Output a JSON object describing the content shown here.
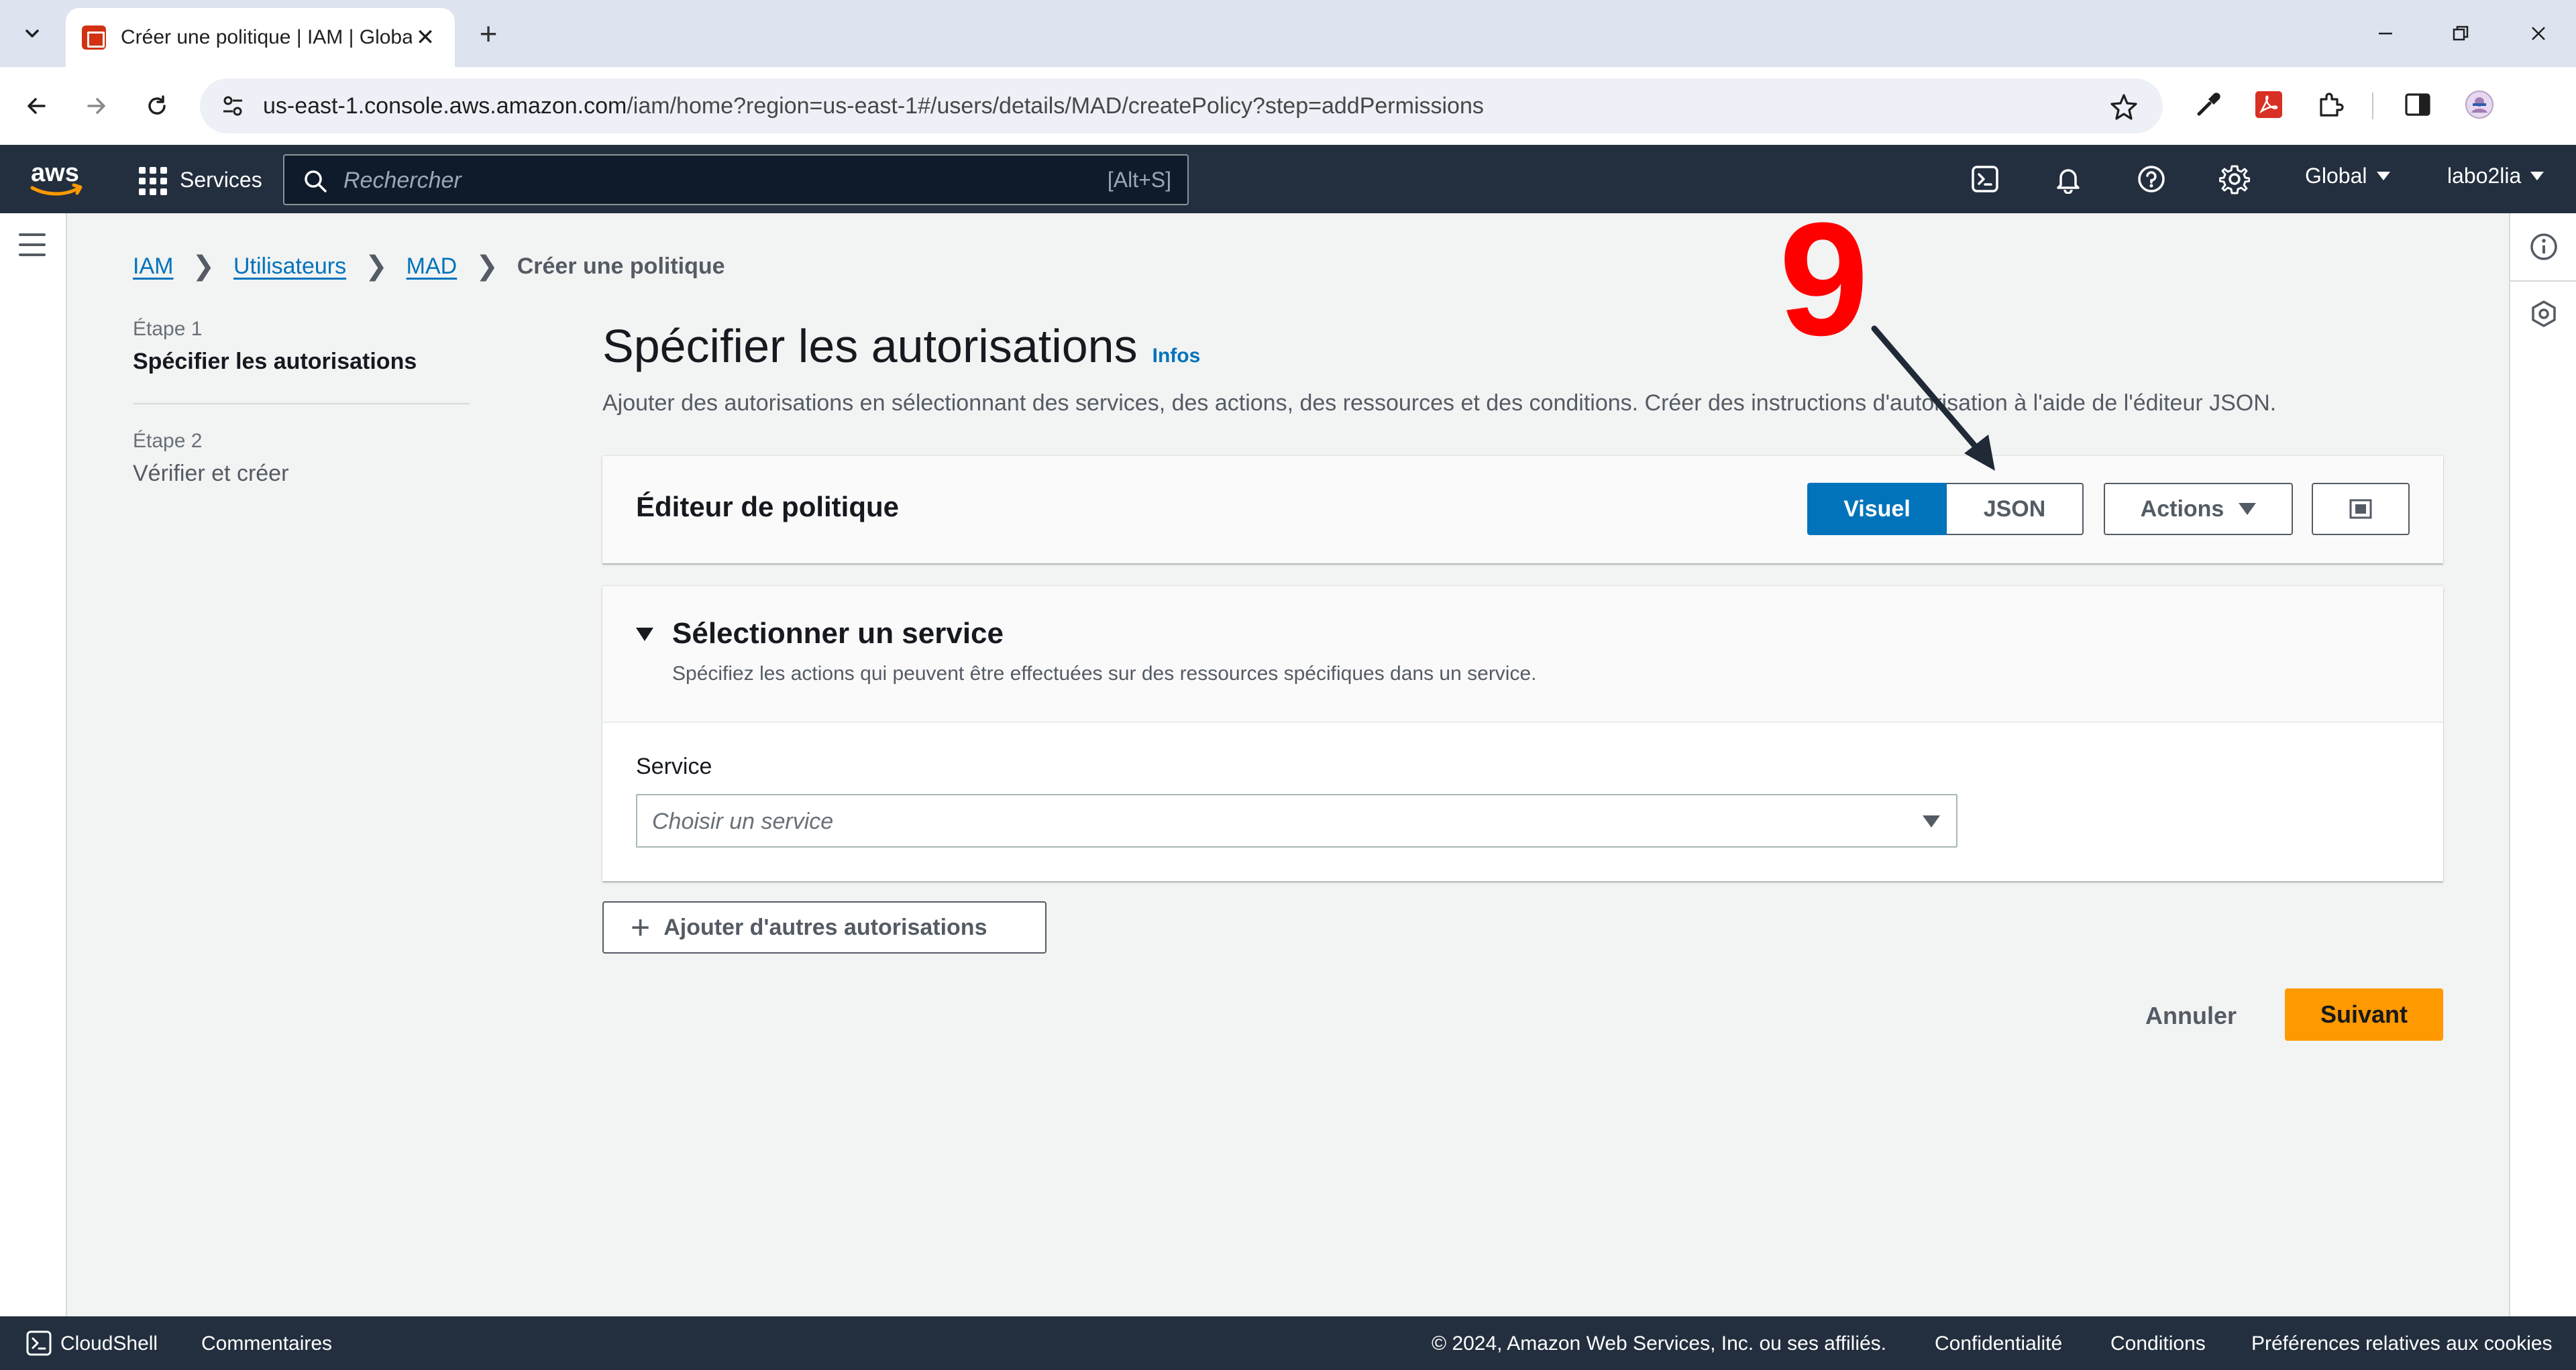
{
  "browser": {
    "tab_title": "Créer une politique | IAM | Global",
    "url_host": "us-east-1.console.aws.amazon.com",
    "url_path": "/iam/home?region=us-east-1#/users/details/MAD/createPolicy?step=addPermissions"
  },
  "aws_header": {
    "logo_text": "aws",
    "services_label": "Services",
    "search_placeholder": "Rechercher",
    "search_shortcut": "[Alt+S]",
    "region": "Global",
    "account": "labo2lia"
  },
  "breadcrumb": {
    "items": [
      "IAM",
      "Utilisateurs",
      "MAD"
    ],
    "current": "Créer une politique"
  },
  "steps": [
    {
      "number": "Étape 1",
      "label": "Spécifier les autorisations"
    },
    {
      "number": "Étape 2",
      "label": "Vérifier et créer"
    }
  ],
  "page": {
    "title": "Spécifier les autorisations",
    "info": "Infos",
    "description": "Ajouter des autorisations en sélectionnant des services, des actions, des ressources et des conditions. Créer des instructions d'autorisation à l'aide de l'éditeur JSON."
  },
  "editor": {
    "title": "Éditeur de politique",
    "visual_label": "Visuel",
    "json_label": "JSON",
    "actions_label": "Actions"
  },
  "service_section": {
    "title": "Sélectionner un service",
    "subtitle": "Spécifiez les actions qui peuvent être effectuées sur des ressources spécifiques dans un service.",
    "field_label": "Service",
    "select_placeholder": "Choisir un service"
  },
  "add_permissions_label": "Ajouter d'autres autorisations",
  "buttons": {
    "cancel": "Annuler",
    "next": "Suivant"
  },
  "annotation": {
    "number": "9"
  },
  "footer": {
    "cloudshell": "CloudShell",
    "comments": "Commentaires",
    "copyright": "© 2024, Amazon Web Services, Inc. ou ses affiliés.",
    "privacy": "Confidentialité",
    "terms": "Conditions",
    "cookies": "Préférences relatives aux cookies"
  },
  "colors": {
    "aws_navy": "#232f3e",
    "link_blue": "#0073bb",
    "primary_orange": "#ff9900",
    "annotation_red": "#ff0000"
  }
}
